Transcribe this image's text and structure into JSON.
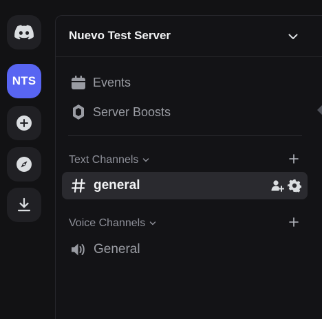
{
  "rail": {
    "items": [
      {
        "name": "home",
        "icon": "discord-logo-icon"
      },
      {
        "name": "server",
        "label": "NTS",
        "color": "#5865f2"
      },
      {
        "name": "add-server",
        "icon": "plus-circle-icon"
      },
      {
        "name": "discover",
        "icon": "compass-icon"
      },
      {
        "name": "download",
        "icon": "download-icon"
      }
    ]
  },
  "server": {
    "name": "Nuevo Test Server"
  },
  "nav": {
    "events_label": "Events",
    "boosts_label": "Server Boosts"
  },
  "categories": {
    "text": {
      "label": "Text Channels",
      "channels": [
        {
          "name": "general",
          "type": "text",
          "active": true
        }
      ]
    },
    "voice": {
      "label": "Voice Channels",
      "channels": [
        {
          "name": "General",
          "type": "voice",
          "active": false
        }
      ]
    }
  },
  "colors": {
    "accent": "#5865f2",
    "background": "#121214",
    "sidebar": "#131316",
    "active_row": "#2a2a2f"
  }
}
